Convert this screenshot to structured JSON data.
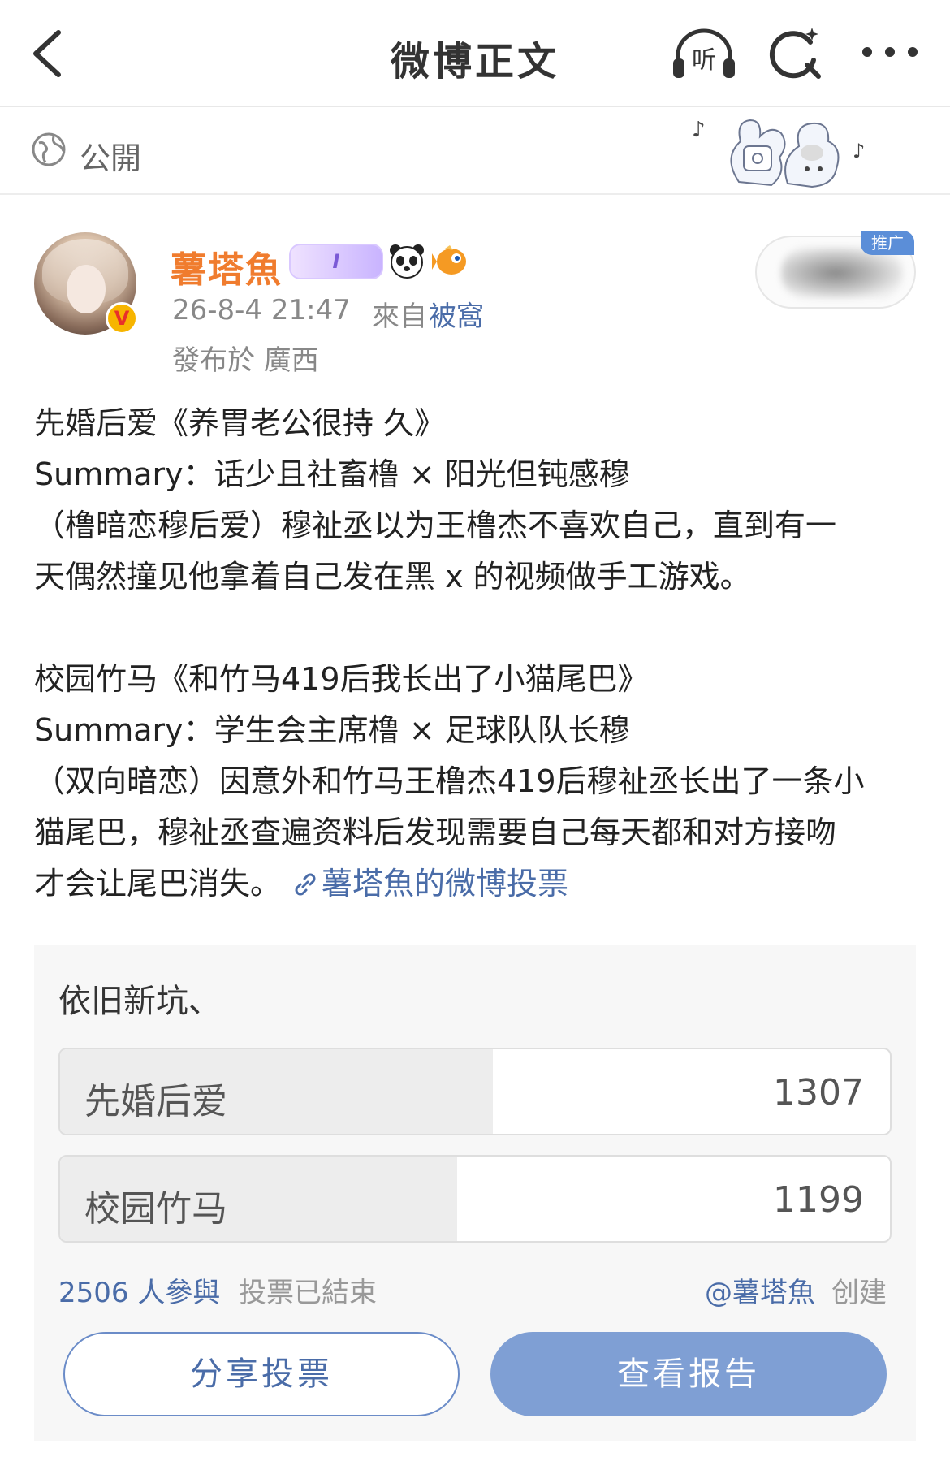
{
  "header": {
    "title": "微博正文",
    "listen_label": "听"
  },
  "visibility": {
    "label": "公開"
  },
  "author": {
    "name": "薯塔魚",
    "level_badge": "I",
    "verified_mark": "V",
    "time": "26-8-4 21:47",
    "source_prefix": "來自",
    "source": "被窩",
    "location": "發布於 廣西"
  },
  "promo": {
    "tag": "推广"
  },
  "post": {
    "lines_a": [
      "先婚后爱《养胃老公很持  久》",
      "Summary：话少且社畜橹 × 阳光但钝感穆",
      "（橹暗恋穆后爱）穆祉丞以为王橹杰不喜欢自己，直到有一",
      "天偶然撞见他拿着自己发在黑 x 的视频做手工游戏。"
    ],
    "lines_b": [
      "校园竹马《和竹马419后我长出了小猫尾巴》",
      "Summary：学生会主席橹 × 足球队队长穆",
      "（双向暗恋）因意外和竹马王橹杰419后穆祉丞长出了一条小",
      "猫尾巴，穆祉丞查遍资料后发现需要自己每天都和对方接吻"
    ],
    "last_line": "才会让尾巴消失。",
    "vote_link": "薯塔魚的微博投票"
  },
  "poll": {
    "title": "依旧新坑、",
    "options": [
      {
        "label": "先婚后爱",
        "count": "1307",
        "share": 0.522
      },
      {
        "label": "校园竹马",
        "count": "1199",
        "share": 0.478
      }
    ],
    "participants": "2506 人參與",
    "status": "投票已結束",
    "creator": "@薯塔魚",
    "created_label": "创建",
    "share_button": "分享投票",
    "report_button": "查看报告"
  },
  "colors": {
    "username": "#f07c2e",
    "link": "#4a6ca8",
    "primary_button": "#7f9fd4"
  }
}
